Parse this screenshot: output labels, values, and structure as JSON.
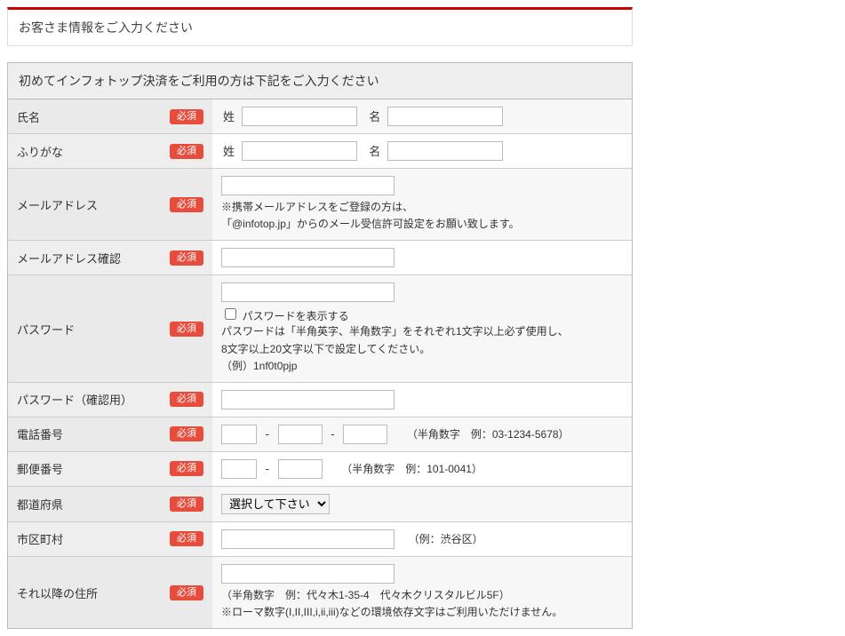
{
  "header": {
    "title": "お客さま情報をご入力ください"
  },
  "section_title": "初めてインフォトップ決済をご利用の方は下記をご入力ください",
  "required_label": "必須",
  "fields": {
    "name": {
      "label": "氏名",
      "last_label": "姓",
      "first_label": "名"
    },
    "kana": {
      "label": "ふりがな",
      "last_label": "姓",
      "first_label": "名"
    },
    "email": {
      "label": "メールアドレス",
      "hint1": "※携帯メールアドレスをご登録の方は、",
      "hint2": "「@infotop.jp」からのメール受信許可設定をお願い致します。"
    },
    "email_confirm": {
      "label": "メールアドレス確認"
    },
    "password": {
      "label": "パスワード",
      "show_label": "パスワードを表示する",
      "hint1": "パスワードは「半角英字、半角数字」をそれぞれ1文字以上必ず使用し、",
      "hint2": "8文字以上20文字以下で設定してください。",
      "hint3": "（例）1nf0t0pjp"
    },
    "password_confirm": {
      "label": "パスワード（確認用）"
    },
    "tel": {
      "label": "電話番号",
      "hint": "（半角数字　例：03-1234-5678）"
    },
    "zip": {
      "label": "郵便番号",
      "hint": "（半角数字　例：101-0041）"
    },
    "pref": {
      "label": "都道府県",
      "placeholder": "選択して下さい"
    },
    "city": {
      "label": "市区町村",
      "hint": "（例：渋谷区）"
    },
    "address": {
      "label": "それ以降の住所",
      "hint1": "（半角数字　例：代々木1-35-4　代々木クリスタルビル5F）",
      "hint2": "※ローマ数字(I,II,III,i,ii,iii)などの環境依存文字はご利用いただけません。"
    }
  },
  "sep": "-"
}
